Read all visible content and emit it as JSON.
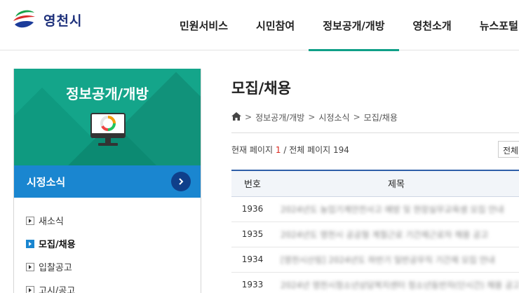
{
  "header": {
    "logo_text": "영천시",
    "nav": [
      "민원서비스",
      "시민참여",
      "정보공개/개방",
      "영천소개",
      "뉴스포털"
    ],
    "active_nav_index": 2,
    "accent_color": "#0fa088"
  },
  "sidebar": {
    "title": "정보공개/개방",
    "section": "시정소식",
    "items": [
      {
        "label": "새소식",
        "active": false
      },
      {
        "label": "모집/채용",
        "active": true
      },
      {
        "label": "입찰공고",
        "active": false
      },
      {
        "label": "고시/공고",
        "active": false
      }
    ],
    "colors": {
      "head": "#14a58a",
      "section": "#1a86d0"
    }
  },
  "content": {
    "title": "모집/채용",
    "breadcrumb": [
      "정보공개/개방",
      "시정소식",
      "모집/채용"
    ],
    "page_info": {
      "prefix": "현재 페이지",
      "current": "1",
      "separator": "/",
      "total_label": "전체 페이지",
      "total": "194"
    },
    "select_value": "전체",
    "table": {
      "headers": [
        "번호",
        "제목"
      ],
      "rows": [
        {
          "num": "1936",
          "title": "2024년도 농업기계안전사고 예방 및 현장실무교육생 모집 안내"
        },
        {
          "num": "1935",
          "title": "2024년도 영천시 공공형 계절근로 기간제근로자 채용 공고"
        },
        {
          "num": "1934",
          "title": "[영천시산림] 2024년도 하반기 일반공무직 기간제 모집 안내"
        },
        {
          "num": "1933",
          "title": "2024년 영천시청소년상담복지센터 청소년동반자(단시간) 채용 공고"
        }
      ]
    }
  }
}
